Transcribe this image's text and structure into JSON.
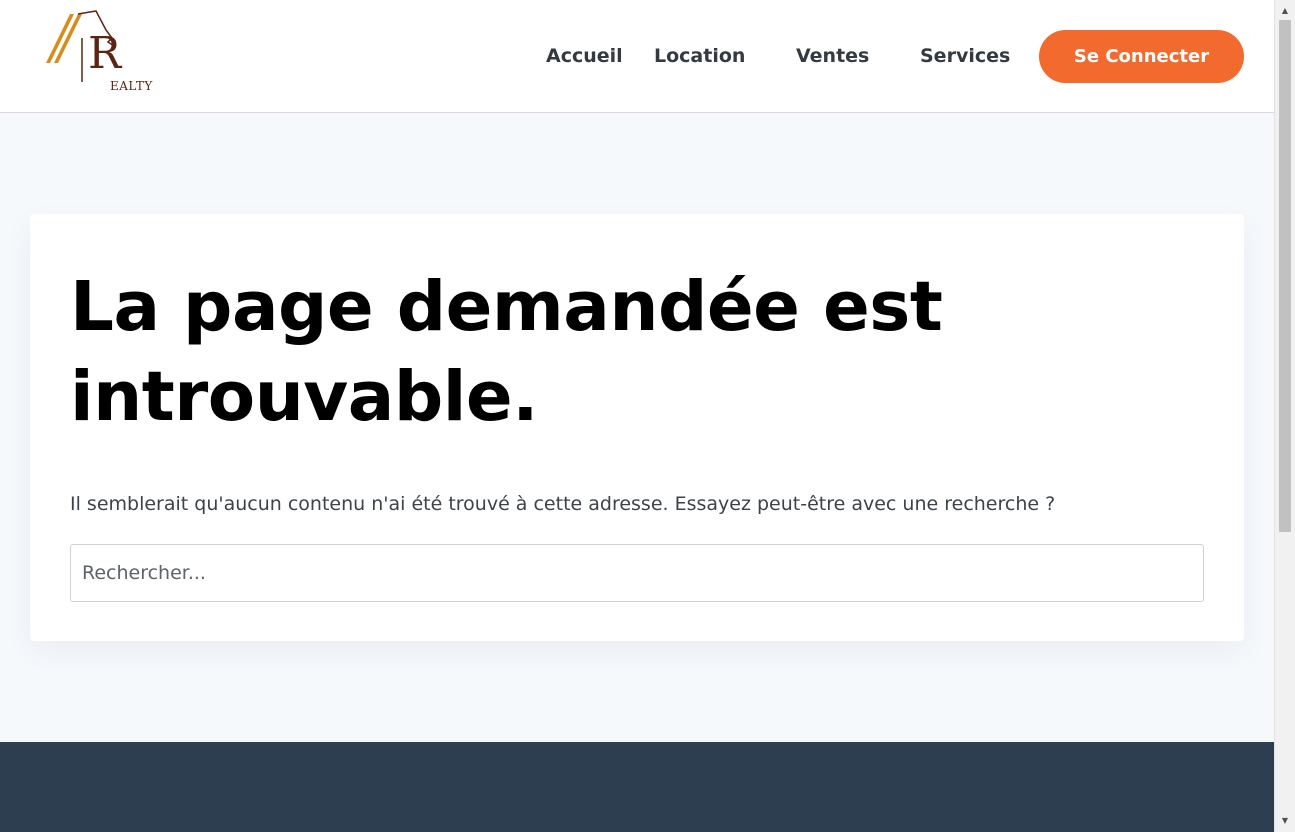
{
  "logo": {
    "letter": "R",
    "suffix": "EALTY",
    "colors": {
      "stripe": "#d98c1c",
      "brand": "#5c2512"
    }
  },
  "nav": {
    "items": [
      {
        "label": "Accueil"
      },
      {
        "label": "Location"
      },
      {
        "label": "Ventes"
      },
      {
        "label": "Services"
      }
    ],
    "connect_label": "Se Connecter"
  },
  "main": {
    "title": "La page demandée est introuvable.",
    "description": "Il semblerait qu'aucun contenu n'ai été trouvé à cette adresse. Essayez peut-être avec une recherche ?",
    "search": {
      "placeholder": "Rechercher...",
      "value": ""
    }
  },
  "colors": {
    "accent": "#f26a2e",
    "footer": "#2d3e50",
    "page_bg": "#f6f9fc"
  },
  "scrollbar": {
    "up_icon": "arrow-up-icon",
    "down_icon": "arrow-down-icon"
  }
}
